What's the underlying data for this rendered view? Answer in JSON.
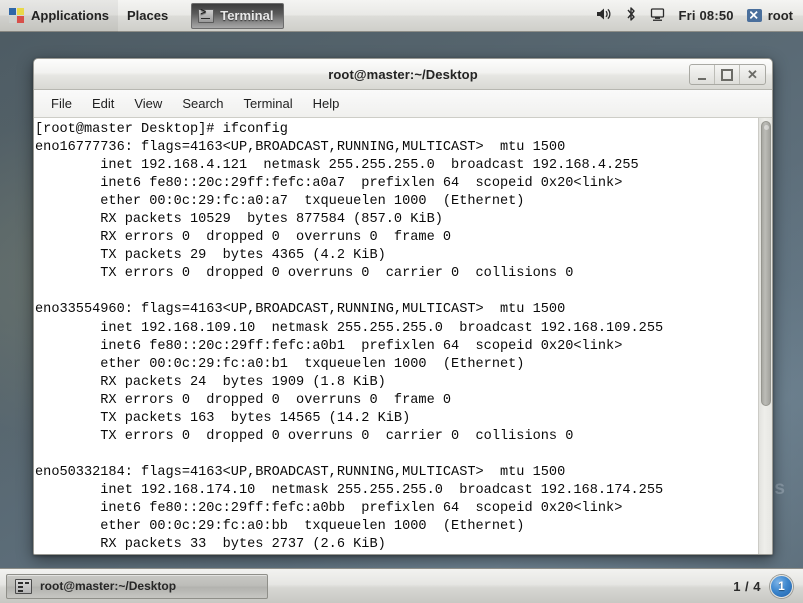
{
  "top_panel": {
    "applications_label": "Applications",
    "places_label": "Places",
    "window_task_label": "Terminal",
    "clock": "Fri 08:50",
    "user_label": "root",
    "tray": {
      "volume_icon": "speaker-icon",
      "bluetooth_icon": "bluetooth-icon",
      "network_icon": "network-display-icon"
    }
  },
  "window": {
    "title": "root@master:~/Desktop",
    "buttons": {
      "minimize": "minimize-button",
      "maximize": "maximize-button",
      "close": "close-button"
    },
    "menus": [
      "File",
      "Edit",
      "View",
      "Search",
      "Terminal",
      "Help"
    ]
  },
  "terminal": {
    "lines": [
      "[root@master Desktop]# ifconfig",
      "eno16777736: flags=4163<UP,BROADCAST,RUNNING,MULTICAST>  mtu 1500",
      "        inet 192.168.4.121  netmask 255.255.255.0  broadcast 192.168.4.255",
      "        inet6 fe80::20c:29ff:fefc:a0a7  prefixlen 64  scopeid 0x20<link>",
      "        ether 00:0c:29:fc:a0:a7  txqueuelen 1000  (Ethernet)",
      "        RX packets 10529  bytes 877584 (857.0 KiB)",
      "        RX errors 0  dropped 0  overruns 0  frame 0",
      "        TX packets 29  bytes 4365 (4.2 KiB)",
      "        TX errors 0  dropped 0 overruns 0  carrier 0  collisions 0",
      "",
      "eno33554960: flags=4163<UP,BROADCAST,RUNNING,MULTICAST>  mtu 1500",
      "        inet 192.168.109.10  netmask 255.255.255.0  broadcast 192.168.109.255",
      "        inet6 fe80::20c:29ff:fefc:a0b1  prefixlen 64  scopeid 0x20<link>",
      "        ether 00:0c:29:fc:a0:b1  txqueuelen 1000  (Ethernet)",
      "        RX packets 24  bytes 1909 (1.8 KiB)",
      "        RX errors 0  dropped 0  overruns 0  frame 0",
      "        TX packets 163  bytes 14565 (14.2 KiB)",
      "        TX errors 0  dropped 0 overruns 0  carrier 0  collisions 0",
      "",
      "eno50332184: flags=4163<UP,BROADCAST,RUNNING,MULTICAST>  mtu 1500",
      "        inet 192.168.174.10  netmask 255.255.255.0  broadcast 192.168.174.255",
      "        inet6 fe80::20c:29ff:fefc:a0bb  prefixlen 64  scopeid 0x20<link>",
      "        ether 00:0c:29:fc:a0:bb  txqueuelen 1000  (Ethernet)",
      "        RX packets 33  bytes 2737 (2.6 KiB)"
    ]
  },
  "bottom_panel": {
    "task_label": "root@master:~/Desktop",
    "workspace_count_label": "1 / 4",
    "workspace_current": "1"
  },
  "desktop": {
    "watermark": "o.s"
  },
  "colors": {
    "accent": "#3d87ce",
    "panel": "#e6e6e3",
    "terminal_bg": "#ffffff",
    "terminal_fg": "#0a0a0a"
  }
}
